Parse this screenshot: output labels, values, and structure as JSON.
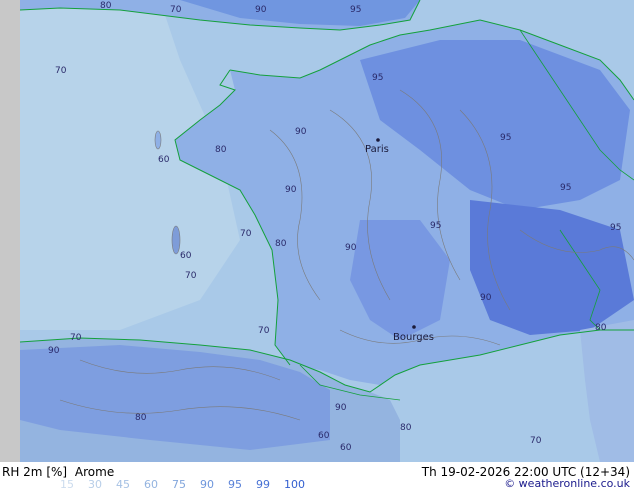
{
  "map": {
    "cities": [
      "Paris",
      "Bourges"
    ],
    "contour_labels": [
      {
        "text": "70"
      },
      {
        "text": "80"
      },
      {
        "text": "90"
      },
      {
        "text": "95"
      },
      {
        "text": "60"
      },
      {
        "text": "70"
      },
      {
        "text": "80"
      },
      {
        "text": "90"
      },
      {
        "text": "95"
      },
      {
        "text": "60"
      },
      {
        "text": "70"
      },
      {
        "text": "80"
      },
      {
        "text": "90"
      },
      {
        "text": "95"
      },
      {
        "text": "70"
      },
      {
        "text": "80"
      },
      {
        "text": "90"
      },
      {
        "text": "95"
      },
      {
        "text": "60"
      },
      {
        "text": "70"
      },
      {
        "text": "80"
      },
      {
        "text": "90"
      },
      {
        "text": "95"
      },
      {
        "text": "70"
      },
      {
        "text": "80"
      },
      {
        "text": "90"
      },
      {
        "text": "95"
      },
      {
        "text": "60"
      },
      {
        "text": "70"
      },
      {
        "text": "90"
      }
    ],
    "colors": {
      "sea_low": "#b7d3ea",
      "sea_mid": "#a5c6e6",
      "land_mid": "#8fb0e6",
      "land_high": "#6e90e0",
      "land_vhigh": "#5a7ad8",
      "coast": "#14a03c",
      "contour": "#7a7a7a",
      "left_strip": "#c8c8c8"
    }
  },
  "footer": {
    "variable": "RH 2m [%]",
    "model": "Arome",
    "datetime": "Th 19-02-2026 22:00 UTC (12+34)",
    "credit": "© weatheronline.co.uk",
    "legend_values": [
      "15",
      "30",
      "45",
      "60",
      "75",
      "90",
      "95",
      "99",
      "100"
    ],
    "legend_colors": [
      "#ccdcee",
      "#b8cee8",
      "#a6c1e4",
      "#94b4e0",
      "#82a6dc",
      "#6e96dc",
      "#5a82d8",
      "#4670d4",
      "#3460d0"
    ]
  }
}
